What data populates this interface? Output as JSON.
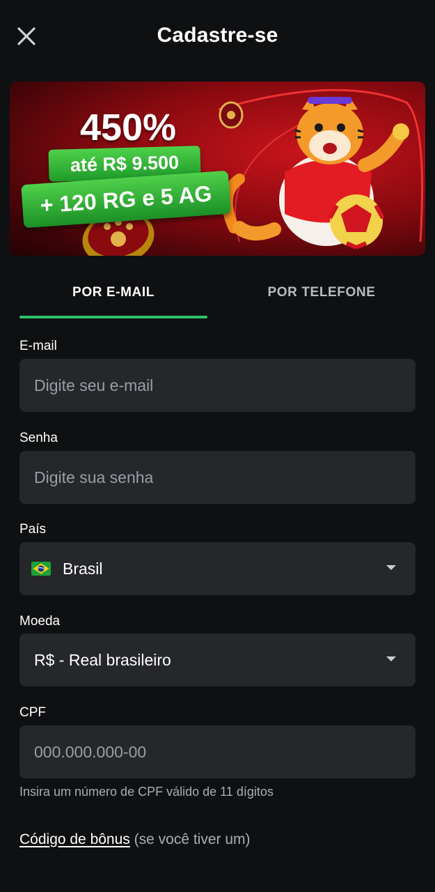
{
  "header": {
    "title": "Cadastre-se",
    "close_icon": "close-icon"
  },
  "banner": {
    "percent": "450%",
    "line1": "até R$ 9.500",
    "line2": "+ 120 RG e 5 AG"
  },
  "tabs": [
    {
      "label": "POR E-MAIL",
      "active": true
    },
    {
      "label": "POR TELEFONE",
      "active": false
    }
  ],
  "form": {
    "email": {
      "label": "E-mail",
      "placeholder": "Digite seu e-mail",
      "value": ""
    },
    "password": {
      "label": "Senha",
      "placeholder": "Digite sua senha",
      "value": ""
    },
    "country": {
      "label": "País",
      "value": "Brasil",
      "flag_icon": "brazil-flag-icon"
    },
    "currency": {
      "label": "Moeda",
      "value": "R$ - Real brasileiro"
    },
    "cpf": {
      "label": "CPF",
      "placeholder": "000.000.000-00",
      "value": "",
      "hint": "Insira um número de CPF válido de 11 dígitos"
    }
  },
  "bonus": {
    "link": "Código de bônus",
    "rest": "(se você tiver um)"
  },
  "colors": {
    "background": "#0f1012",
    "field_bg": "#25272b",
    "accent_green": "#2fbf6b"
  }
}
